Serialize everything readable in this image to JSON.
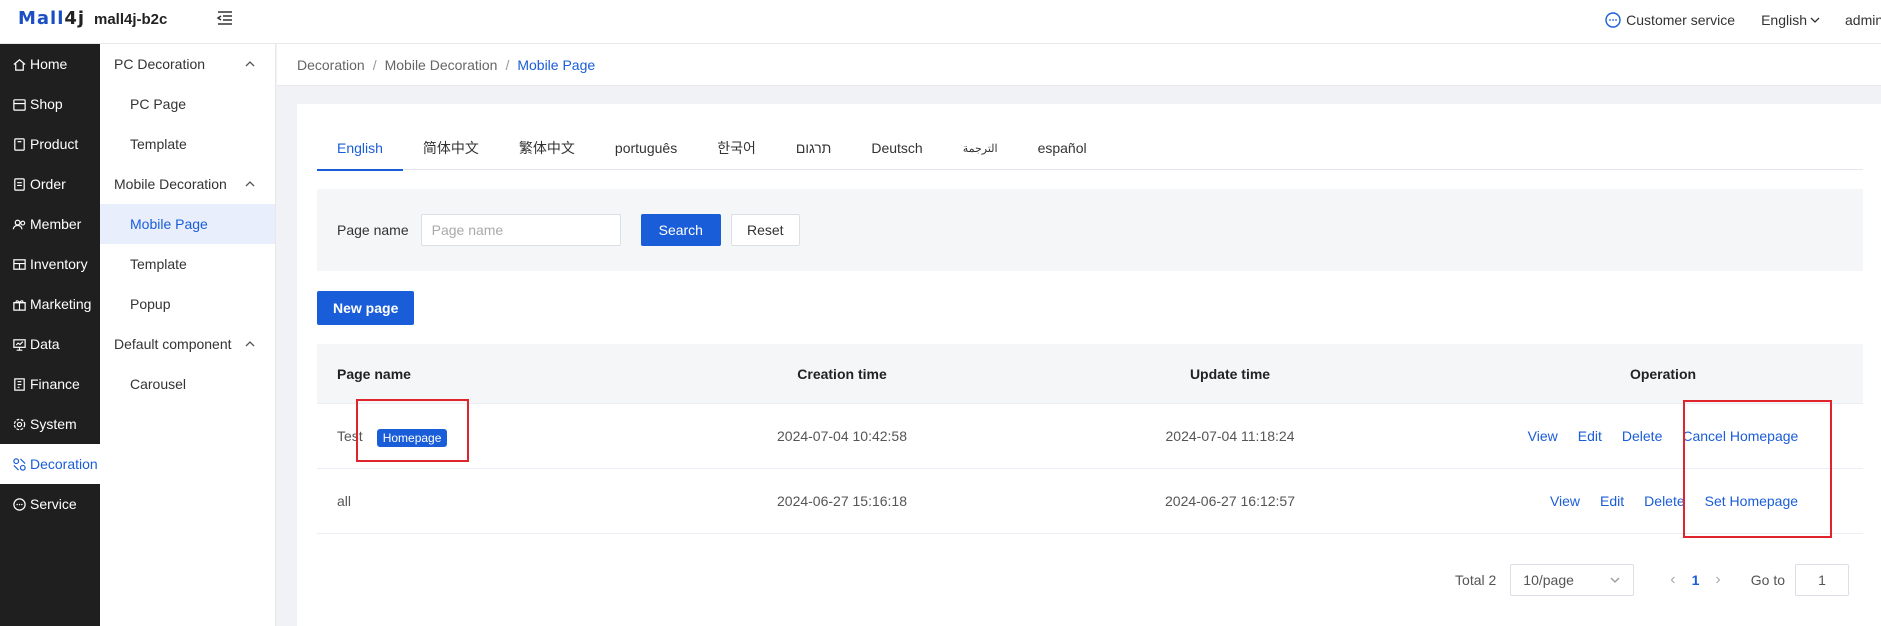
{
  "header": {
    "logo_part1": "Mall",
    "logo_part2": "4j",
    "app_name": "mall4j-b2c",
    "customer_service": "Customer service",
    "language": "English",
    "user": "admin"
  },
  "sidebar": {
    "items": [
      {
        "label": "Home",
        "icon": "home-icon"
      },
      {
        "label": "Shop",
        "icon": "shop-icon"
      },
      {
        "label": "Product",
        "icon": "product-icon"
      },
      {
        "label": "Order",
        "icon": "order-icon"
      },
      {
        "label": "Member",
        "icon": "member-icon"
      },
      {
        "label": "Inventory",
        "icon": "inventory-icon"
      },
      {
        "label": "Marketing",
        "icon": "gift-icon"
      },
      {
        "label": "Data",
        "icon": "data-icon"
      },
      {
        "label": "Finance",
        "icon": "finance-icon"
      },
      {
        "label": "System",
        "icon": "gear-icon"
      },
      {
        "label": "Decoration",
        "icon": "decoration-icon"
      },
      {
        "label": "Service",
        "icon": "chat-icon"
      }
    ],
    "active": "Decoration"
  },
  "subsidebar": {
    "groups": [
      {
        "label": "PC Decoration",
        "items": [
          "PC Page",
          "Template"
        ]
      },
      {
        "label": "Mobile Decoration",
        "items": [
          "Mobile Page",
          "Template",
          "Popup"
        ]
      },
      {
        "label": "Default component",
        "items": [
          "Carousel"
        ]
      }
    ],
    "active": "Mobile Page"
  },
  "breadcrumb": [
    "Decoration",
    "Mobile Decoration",
    "Mobile Page"
  ],
  "tabs": [
    "English",
    "简体中文",
    "繁体中文",
    "português",
    "한국어",
    "תרגום",
    "Deutsch",
    "الترجمة",
    "español"
  ],
  "search": {
    "label": "Page name",
    "placeholder": "Page name",
    "search_button": "Search",
    "reset_button": "Reset"
  },
  "new_page_button": "New page",
  "table": {
    "headers": [
      "Page name",
      "Creation time",
      "Update time",
      "Operation"
    ],
    "rows": [
      {
        "name": "Test",
        "tag": "Homepage",
        "created": "2024-07-04 10:42:58",
        "updated": "2024-07-04 11:18:24",
        "ops": [
          "View",
          "Edit",
          "Delete",
          "Cancel Homepage"
        ]
      },
      {
        "name": "all",
        "tag": "",
        "created": "2024-06-27 15:16:18",
        "updated": "2024-06-27 16:12:57",
        "ops": [
          "View",
          "Edit",
          "Delete",
          "Set Homepage"
        ]
      }
    ]
  },
  "pagination": {
    "total": "Total 2",
    "page_size": "10/page",
    "current_page": "1",
    "goto_label": "Go to",
    "goto_value": "1"
  },
  "colors": {
    "primary": "#1a5dd8",
    "sidebar_bg": "#1f1f1f",
    "highlight_box": "#e0242c"
  }
}
